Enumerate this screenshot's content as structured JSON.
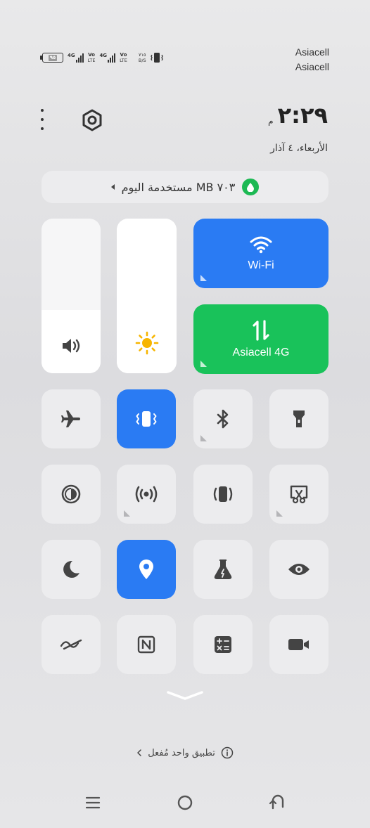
{
  "status_bar": {
    "battery_level": "٩٥",
    "sim1": {
      "network": "4G",
      "volte_top": "Vo",
      "volte_bottom": "LTE"
    },
    "sim2": {
      "network": "4G",
      "volte_top": "Vo",
      "volte_bottom": "LTE"
    },
    "speed_value": "٧١٥",
    "speed_unit": "B/S",
    "carriers": [
      "Asiacell",
      "Asiacell"
    ]
  },
  "header": {
    "time": "٢:٢٩",
    "ampm": "م",
    "date": "الأربعاء، ٤ آذار"
  },
  "data_usage": {
    "text": "٧٠٣ MB مستخدمة اليوم"
  },
  "sliders": {
    "volume": {
      "level": 0.41,
      "icon": "speaker-icon"
    },
    "brightness": {
      "level": 1.0,
      "icon": "sun-icon"
    }
  },
  "big_tiles": {
    "wifi": {
      "label": "Wi-Fi",
      "icon": "wifi-icon",
      "color": "#2a7bf3"
    },
    "mobile_data": {
      "label": "Asiacell 4G",
      "icon": "data-arrows-icon",
      "color": "#19c25a"
    }
  },
  "tiles": [
    {
      "icon": "airplane-icon",
      "active": false
    },
    {
      "icon": "vibrate-icon",
      "active": true
    },
    {
      "icon": "bluetooth-icon",
      "active": false
    },
    {
      "icon": "flashlight-icon",
      "active": false
    },
    {
      "icon": "dark-mode-icon",
      "active": false
    },
    {
      "icon": "hotspot-icon",
      "active": false
    },
    {
      "icon": "auto-rotate-icon",
      "active": false
    },
    {
      "icon": "screenshot-icon",
      "active": false
    },
    {
      "icon": "do-not-disturb-icon",
      "active": false
    },
    {
      "icon": "location-icon",
      "active": true
    },
    {
      "icon": "lab-icon",
      "active": false
    },
    {
      "icon": "eye-comfort-icon",
      "active": false
    },
    {
      "icon": "invert-icon",
      "active": false
    },
    {
      "icon": "nfc-icon",
      "active": false
    },
    {
      "icon": "calculator-icon",
      "active": false
    },
    {
      "icon": "screen-record-icon",
      "active": false
    }
  ],
  "footer": {
    "active_apps": "تطبيق واحد مُفعل"
  },
  "colors": {
    "accent_blue": "#2a7bf3",
    "accent_green": "#19c25a",
    "tile_bg": "#ececee"
  }
}
